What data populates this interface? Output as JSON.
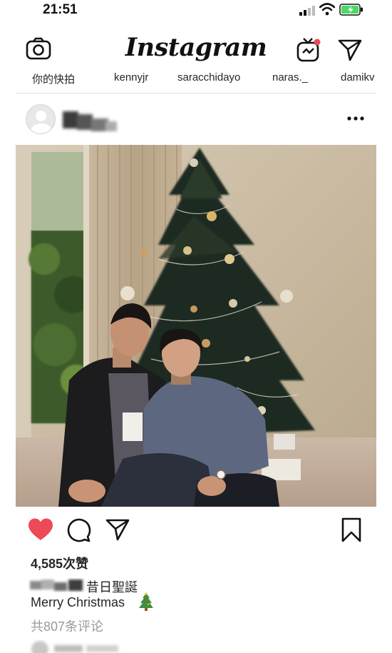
{
  "status_bar": {
    "time": "21:51"
  },
  "header": {
    "logo": "Instagram"
  },
  "stories": [
    {
      "label": "你的快拍"
    },
    {
      "label": "kennyjr"
    },
    {
      "label": "saracchidayo"
    },
    {
      "label": "naras._"
    },
    {
      "label": "damikv"
    }
  ],
  "post": {
    "likes": "4,585次赞",
    "caption_title": "昔日聖誕",
    "caption_text": "Merry Christmas",
    "view_comments": "共807条评论"
  },
  "colors": {
    "like_red": "#ed4956",
    "battery_green": "#4cd964",
    "notification_dot": "#ed4956",
    "muted_text": "#9a9a9a"
  },
  "icons": [
    "camera-icon",
    "igtv-icon",
    "direct-message-icon",
    "more-options-icon",
    "heart-icon",
    "comment-icon",
    "share-icon",
    "bookmark-icon",
    "christmas-tree-emoji"
  ]
}
